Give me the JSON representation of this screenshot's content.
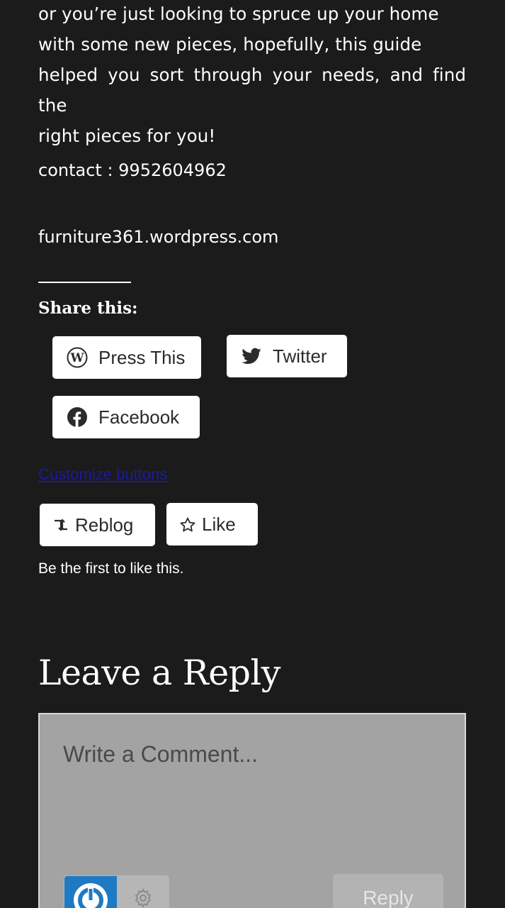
{
  "article": {
    "intro_lines": [
      "or you’re just looking to spruce up your home",
      "with some new pieces, hopefully, this guide",
      "helped you sort through your needs, and find the",
      "right pieces for you!"
    ],
    "contact": "contact : 9952604962",
    "website": "furniture361.wordpress.com"
  },
  "share": {
    "title": "Share this:",
    "buttons": [
      {
        "label": "Press This",
        "icon": "wordpress-icon"
      },
      {
        "label": "Twitter",
        "icon": "twitter-icon"
      },
      {
        "label": "Facebook",
        "icon": "facebook-icon"
      }
    ],
    "customize_link": "Customize buttons"
  },
  "engagement": {
    "reblog_label": "Reblog",
    "like_label": "Like",
    "likes_text": "Be the first to like this."
  },
  "comments": {
    "heading": "Leave a Reply",
    "placeholder": "Write a Comment...",
    "submit_label": "Reply"
  },
  "colors": {
    "background": "#1b1b1b",
    "text": "#ffffff",
    "button_bg": "#ffffff",
    "link": "#1a1aa0",
    "comment_box": "#a3a3a3",
    "wordpress_blue": "#1e7ac3"
  }
}
